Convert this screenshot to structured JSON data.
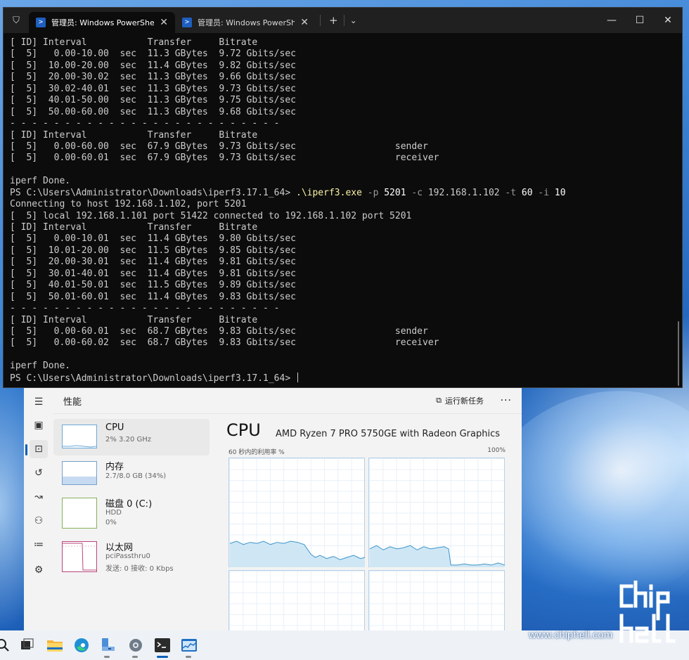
{
  "terminal": {
    "tabs": [
      {
        "title": "管理员: Windows PowerShell",
        "active": true
      },
      {
        "title": "管理员: Windows PowerShell",
        "active": false
      }
    ],
    "new_tab": "+",
    "dropdown": "⌄",
    "controls": {
      "minimize": "—",
      "maximize": "☐",
      "close": "✕"
    },
    "lines": [
      "[ ID] Interval           Transfer     Bitrate",
      "[  5]   0.00-10.00  sec  11.3 GBytes  9.72 Gbits/sec",
      "[  5]  10.00-20.00  sec  11.4 GBytes  9.82 Gbits/sec",
      "[  5]  20.00-30.02  sec  11.3 GBytes  9.66 Gbits/sec",
      "[  5]  30.02-40.01  sec  11.3 GBytes  9.73 Gbits/sec",
      "[  5]  40.01-50.00  sec  11.3 GBytes  9.75 Gbits/sec",
      "[  5]  50.00-60.00  sec  11.3 GBytes  9.68 Gbits/sec",
      "- - - - - - - - - - - - - - - - - - - - - - - - -",
      "[ ID] Interval           Transfer     Bitrate",
      "[  5]   0.00-60.00  sec  67.9 GBytes  9.73 Gbits/sec                  sender",
      "[  5]   0.00-60.01  sec  67.9 GBytes  9.73 Gbits/sec                  receiver",
      "",
      "iperf Done.",
      "__CMD__",
      "Connecting to host 192.168.1.102, port 5201",
      "[  5] local 192.168.1.101 port 51422 connected to 192.168.1.102 port 5201",
      "[ ID] Interval           Transfer     Bitrate",
      "[  5]   0.00-10.01  sec  11.4 GBytes  9.80 Gbits/sec",
      "[  5]  10.01-20.00  sec  11.5 GBytes  9.85 Gbits/sec",
      "[  5]  20.00-30.01  sec  11.4 GBytes  9.81 Gbits/sec",
      "[  5]  30.01-40.01  sec  11.4 GBytes  9.81 Gbits/sec",
      "[  5]  40.01-50.01  sec  11.5 GBytes  9.89 Gbits/sec",
      "[  5]  50.01-60.01  sec  11.4 GBytes  9.83 Gbits/sec",
      "- - - - - - - - - - - - - - - - - - - - - - - - -",
      "[ ID] Interval           Transfer     Bitrate",
      "[  5]   0.00-60.01  sec  68.7 GBytes  9.83 Gbits/sec                  sender",
      "[  5]   0.00-60.02  sec  68.7 GBytes  9.83 Gbits/sec                  receiver",
      "",
      "iperf Done.",
      "__PROMPT__"
    ],
    "prompt": "PS C:\\Users\\Administrator\\Downloads\\iperf3.17.1_64> ",
    "command": {
      "exe": ".\\iperf3.exe",
      "parts": [
        {
          "t": " -p ",
          "c": "arg"
        },
        {
          "t": "5201",
          "c": "val"
        },
        {
          "t": " -c ",
          "c": "arg"
        },
        {
          "t": "192.168.1.102",
          "c": "plain"
        },
        {
          "t": " -t ",
          "c": "arg"
        },
        {
          "t": "60",
          "c": "val"
        },
        {
          "t": " -i ",
          "c": "arg"
        },
        {
          "t": "10",
          "c": "val"
        }
      ]
    }
  },
  "taskmgr": {
    "section_title": "性能",
    "run_task": "运行新任务",
    "more": "···",
    "items": [
      {
        "name": "CPU",
        "sub1": "2% 3.20 GHz",
        "sub2": "",
        "sub3": ""
      },
      {
        "name": "内存",
        "sub1": "2.7/8.0 GB (34%)",
        "sub2": "",
        "sub3": ""
      },
      {
        "name": "磁盘 0 (C:)",
        "sub1": "HDD",
        "sub2": "0%",
        "sub3": ""
      },
      {
        "name": "以太网",
        "sub1": "pciPassthru0",
        "sub2": "发送: 0 接收: 0 Kbps",
        "sub3": ""
      }
    ],
    "main": {
      "title": "CPU",
      "model": "AMD Ryzen 7 PRO 5750GE with Radeon Graphics",
      "util_label": "60 秒内的利用率 %",
      "util_max": "100%"
    },
    "rail_icons": [
      "menu-icon",
      "processes-icon",
      "performance-icon",
      "history-icon",
      "startup-icon",
      "users-icon",
      "details-icon",
      "services-icon"
    ]
  },
  "chart_data": [
    {
      "type": "area",
      "title": "CPU core 0 utilization",
      "ylim": [
        0,
        100
      ],
      "x": [
        0,
        3,
        6,
        9,
        12,
        15,
        18,
        21,
        24,
        27,
        30,
        33,
        36,
        38,
        40,
        43,
        46,
        49,
        52,
        55,
        58,
        60
      ],
      "values": [
        22,
        24,
        21,
        23,
        22,
        24,
        21,
        23,
        22,
        24,
        23,
        21,
        12,
        9,
        11,
        8,
        10,
        7,
        9,
        11,
        8,
        9
      ]
    },
    {
      "type": "area",
      "title": "CPU core 1 utilization",
      "ylim": [
        0,
        100
      ],
      "x": [
        0,
        3,
        6,
        9,
        12,
        15,
        18,
        21,
        24,
        27,
        30,
        33,
        35,
        36,
        39,
        42,
        45,
        48,
        51,
        54,
        57,
        60
      ],
      "values": [
        17,
        20,
        16,
        19,
        17,
        18,
        20,
        16,
        19,
        17,
        18,
        19,
        17,
        2,
        2,
        3,
        2,
        2,
        3,
        2,
        4,
        2
      ]
    }
  ],
  "taskbar": {
    "icons": [
      "search-icon",
      "task-view-icon",
      "file-explorer-icon",
      "edge-icon",
      "network-share-icon",
      "settings-icon",
      "terminal-icon",
      "task-manager-icon"
    ]
  },
  "watermark": {
    "logo": "chip\nhell",
    "url": "www.chiphell.com"
  }
}
